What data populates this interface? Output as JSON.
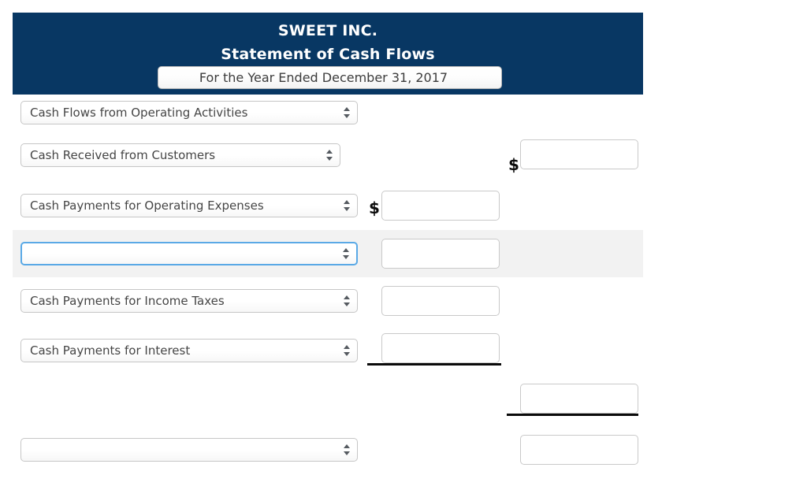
{
  "header": {
    "company_name": "SWEET INC.",
    "statement_title": "Statement of Cash Flows",
    "period_select": {
      "value": "For the Year Ended December 31, 2017",
      "icon": "select-stepper-icon"
    },
    "background_color": "#083763",
    "text_color": "#ffffff"
  },
  "colors": {
    "header_navy": "#083763",
    "focus_blue": "#5aa9e6",
    "row_highlight_gray": "#f2f2f2",
    "control_border": "#c6c6c6",
    "label_text": "#454545",
    "rule_black": "#0a0a0a"
  },
  "rows": [
    {
      "id": "operating-activities-section",
      "select": {
        "value": "Cash Flows from Operating Activities",
        "placeholder": ""
      },
      "amount_left": null,
      "amount_right": null,
      "dollar_left": false,
      "dollar_right": false,
      "highlighted": false
    },
    {
      "id": "cash-received-from-customers",
      "select": {
        "value": "Cash Received from Customers",
        "placeholder": ""
      },
      "amount_right": {
        "value": "",
        "placeholder": ""
      },
      "dollar_right": "$",
      "highlighted": false
    },
    {
      "id": "cash-payments-for-operating-expenses",
      "select": {
        "value": "Cash Payments for Operating Expenses",
        "placeholder": ""
      },
      "amount_left": {
        "value": "",
        "placeholder": ""
      },
      "dollar_left": "$",
      "highlighted": false
    },
    {
      "id": "blank-entry-row-focused",
      "select": {
        "value": "",
        "placeholder": ""
      },
      "amount_left": {
        "value": "",
        "placeholder": ""
      },
      "dollar_left": false,
      "highlighted": true,
      "focused": true
    },
    {
      "id": "cash-payments-for-income-taxes",
      "select": {
        "value": "Cash Payments for Income Taxes",
        "placeholder": ""
      },
      "amount_left": {
        "value": "",
        "placeholder": ""
      },
      "highlighted": false
    },
    {
      "id": "cash-payments-for-interest",
      "select": {
        "value": "Cash Payments for Interest",
        "placeholder": ""
      },
      "amount_left": {
        "value": "",
        "placeholder": ""
      },
      "subtotal_rule": true,
      "highlighted": false
    },
    {
      "id": "net-cash-subtotal-row",
      "select": null,
      "amount_right": {
        "value": "",
        "placeholder": ""
      },
      "subtotal_rule": true,
      "highlighted": false
    },
    {
      "id": "blank-entry-row-last",
      "select": {
        "value": "",
        "placeholder": ""
      },
      "amount_right": {
        "value": "",
        "placeholder": ""
      },
      "highlighted": false
    }
  ]
}
